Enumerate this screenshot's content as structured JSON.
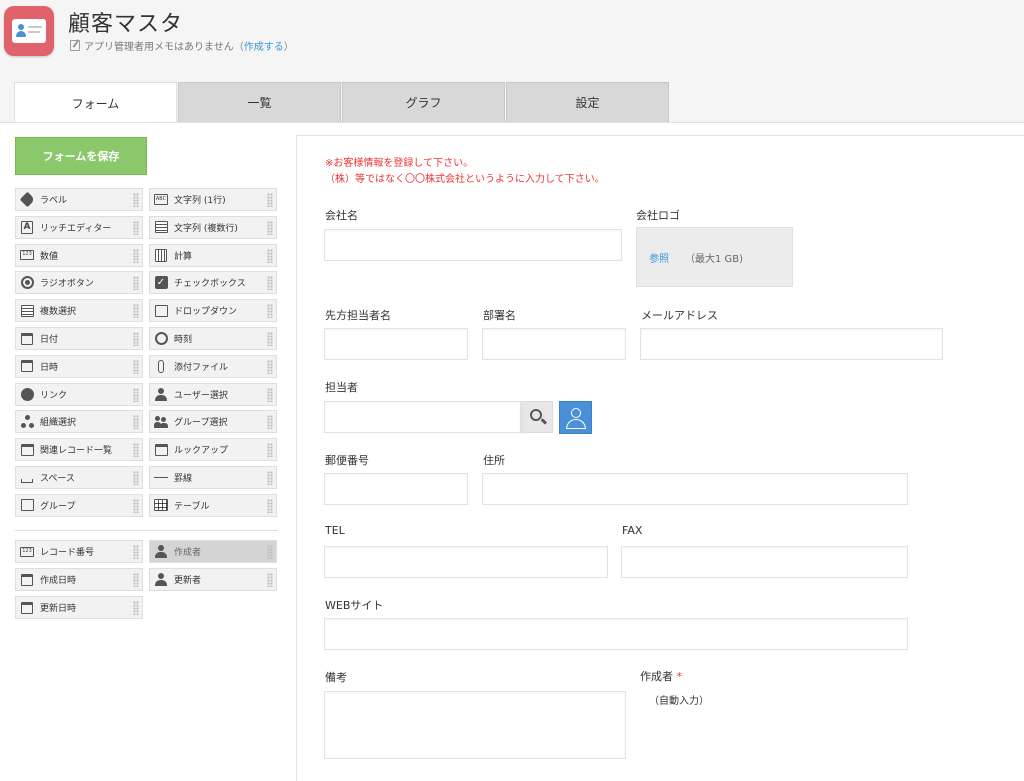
{
  "header": {
    "title": "顧客マスタ",
    "memo_text": "アプリ管理者用メモはありません（",
    "memo_link": "作成する",
    "memo_close": "）"
  },
  "tabs": [
    {
      "label": "フォーム",
      "active": true
    },
    {
      "label": "一覧",
      "active": false
    },
    {
      "label": "グラフ",
      "active": false
    },
    {
      "label": "設定",
      "active": false
    }
  ],
  "palette": {
    "save_label": "フォームを保存",
    "fields": [
      {
        "label": "ラベル",
        "icon": "tag-icon"
      },
      {
        "label": "文字列 (1行)",
        "icon": "abc-icon"
      },
      {
        "label": "リッチエディター",
        "icon": "rich-text-icon"
      },
      {
        "label": "文字列 (複数行)",
        "icon": "multiline-text-icon"
      },
      {
        "label": "数値",
        "icon": "number-icon"
      },
      {
        "label": "計算",
        "icon": "calculator-icon"
      },
      {
        "label": "ラジオボタン",
        "icon": "radio-icon"
      },
      {
        "label": "チェックボックス",
        "icon": "checkbox-icon"
      },
      {
        "label": "複数選択",
        "icon": "multi-select-icon"
      },
      {
        "label": "ドロップダウン",
        "icon": "dropdown-icon"
      },
      {
        "label": "日付",
        "icon": "date-icon"
      },
      {
        "label": "時刻",
        "icon": "clock-icon"
      },
      {
        "label": "日時",
        "icon": "datetime-icon"
      },
      {
        "label": "添付ファイル",
        "icon": "paperclip-icon"
      },
      {
        "label": "リンク",
        "icon": "globe-icon"
      },
      {
        "label": "ユーザー選択",
        "icon": "user-icon"
      },
      {
        "label": "組織選択",
        "icon": "org-icon"
      },
      {
        "label": "グループ選択",
        "icon": "group-icon"
      },
      {
        "label": "関連レコード一覧",
        "icon": "related-records-icon"
      },
      {
        "label": "ルックアップ",
        "icon": "lookup-icon"
      },
      {
        "label": "スペース",
        "icon": "space-icon"
      },
      {
        "label": "罫線",
        "icon": "line-icon"
      },
      {
        "label": "グループ",
        "icon": "group-field-icon"
      },
      {
        "label": "テーブル",
        "icon": "table-icon"
      }
    ],
    "system_fields": [
      {
        "label": "レコード番号",
        "icon": "number-icon",
        "disabled": false
      },
      {
        "label": "作成者",
        "icon": "user-icon",
        "disabled": true
      },
      {
        "label": "作成日時",
        "icon": "datetime-icon",
        "disabled": false
      },
      {
        "label": "更新者",
        "icon": "user-icon",
        "disabled": false
      },
      {
        "label": "更新日時",
        "icon": "datetime-icon",
        "disabled": false
      }
    ]
  },
  "form": {
    "notice_line1": "※お客様情報を登録して下さい。",
    "notice_line2": "（株）等ではなく〇〇株式会社というように入力して下さい。",
    "company_name": "会社名",
    "company_logo": "会社ロゴ",
    "logo_browse": "参照",
    "logo_max": "（最大1 GB)",
    "contact_name": "先方担当者名",
    "department": "部署名",
    "email": "メールアドレス",
    "owner": "担当者",
    "postal_code": "郵便番号",
    "address": "住所",
    "tel": "TEL",
    "fax": "FAX",
    "website": "WEBサイト",
    "notes": "備考",
    "creator": "作成者",
    "required_mark": "*",
    "auto_input": "（自動入力）"
  }
}
